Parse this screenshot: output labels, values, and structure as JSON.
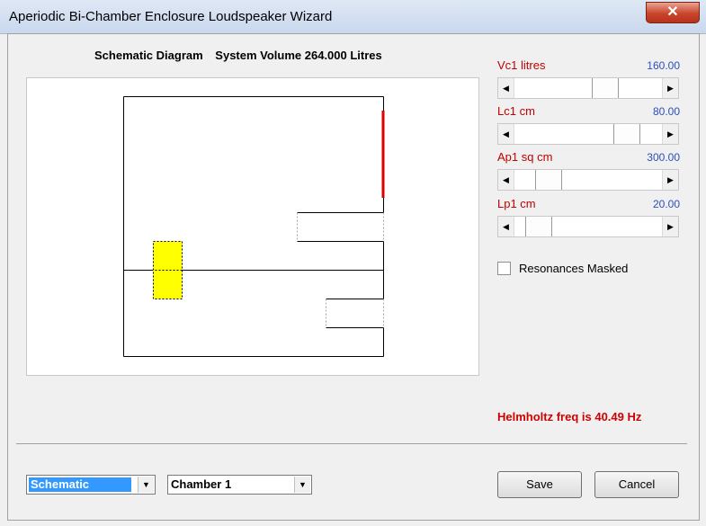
{
  "window": {
    "title": "Aperiodic Bi-Chamber Enclosure Loudspeaker Wizard",
    "close_glyph": "✕"
  },
  "diagram": {
    "label": "Schematic Diagram",
    "volume_text": "System Volume 264.000 Litres"
  },
  "params": [
    {
      "label": "Vc1  litres",
      "value": "160.00",
      "thumb_fraction": 0.64
    },
    {
      "label": "Lc1  cm",
      "value": "80.00",
      "thumb_fraction": 0.82
    },
    {
      "label": "Ap1  sq cm",
      "value": "300.00",
      "thumb_fraction": 0.17
    },
    {
      "label": "Lp1  cm",
      "value": "20.00",
      "thumb_fraction": 0.09
    }
  ],
  "resonances": {
    "label": "Resonances Masked",
    "checked": false
  },
  "helmholtz": "Helmholtz freq is 40.49 Hz",
  "view_select": {
    "value": "Schematic"
  },
  "chamber_select": {
    "value": "Chamber 1"
  },
  "buttons": {
    "save": "Save",
    "cancel": "Cancel"
  },
  "icons": {
    "left_arrow": "◀",
    "right_arrow": "▶",
    "dropdown": "▼"
  },
  "colors": {
    "param_label": "#c00000",
    "param_value": "#2a4fbd",
    "helmholtz": "#d00000",
    "driver": "#ffff00",
    "baffle": "#dd0000"
  }
}
